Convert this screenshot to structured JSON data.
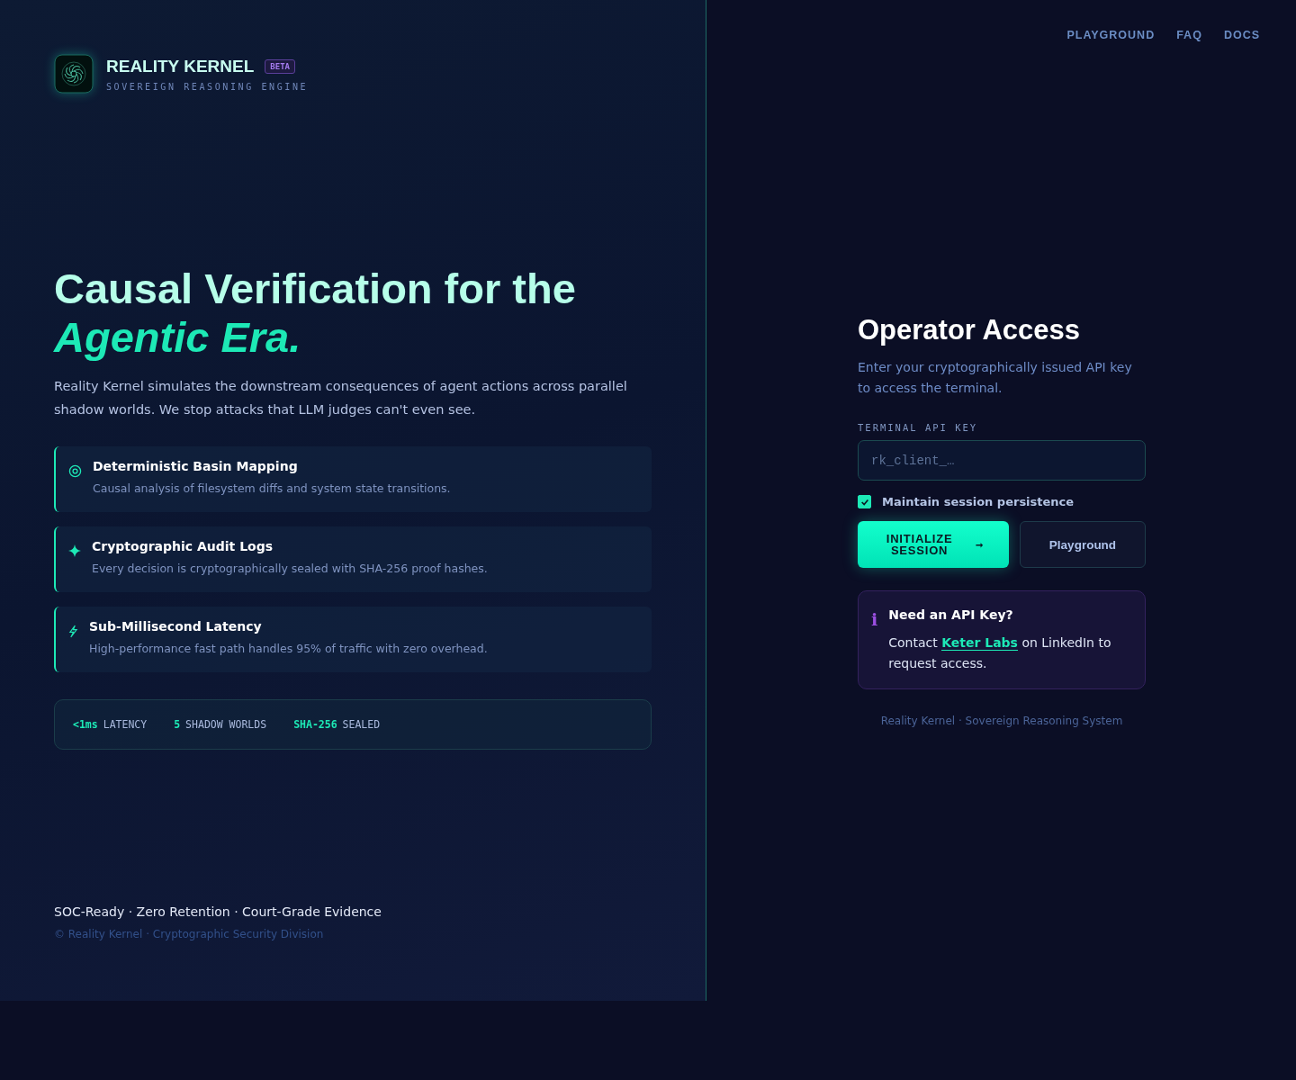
{
  "brand": {
    "title": "REALITY KERNEL",
    "badge": "BETA",
    "subtitle": "SOVEREIGN REASONING ENGINE"
  },
  "nav": [
    "PLAYGROUND",
    "FAQ",
    "DOCS"
  ],
  "hero": {
    "title": "Causal Verification for the",
    "accent": "Agentic Era.",
    "description": "Reality Kernel simulates the downstream consequences of agent actions across parallel shadow worlds. We stop attacks that LLM judges can't even see."
  },
  "features": [
    {
      "kind": "target",
      "title": "Deterministic Basin Mapping",
      "description": "Causal analysis of filesystem diffs and system state transitions."
    },
    {
      "kind": "sparkle",
      "title": "Cryptographic Audit Logs",
      "description": "Every decision is cryptographically sealed with SHA-256 proof hashes."
    },
    {
      "kind": "bolt",
      "title": "Sub-Millisecond Latency",
      "description": "High-performance fast path handles 95% of traffic with zero overhead."
    }
  ],
  "stats": [
    {
      "value": "<1ms",
      "label": "LATENCY"
    },
    {
      "value": "5",
      "label": "SHADOW WORLDS"
    },
    {
      "value": "SHA-256",
      "label": "SEALED"
    }
  ],
  "footer": {
    "tagline": "SOC-Ready · Zero Retention · Court-Grade Evidence",
    "copyright": "© Reality Kernel · Cryptographic Security Division"
  },
  "login": {
    "title": "Operator Access",
    "description": "Enter your cryptographically issued API key to access the terminal.",
    "field_label": "TERMINAL API KEY",
    "placeholder": "rk_client_…",
    "checkbox": {
      "label": "Maintain session persistence",
      "checked": true
    },
    "primary_button": "INITIALIZE SESSION",
    "primary_arrow": "➞",
    "secondary_button": "Playground"
  },
  "info": {
    "icon": "i",
    "title": "Need an API Key?",
    "text_before": "Contact",
    "link": "Keter Labs",
    "text_after": "on LinkedIn to request access."
  },
  "footer_note": "Reality Kernel · Sovereign Reasoning System"
}
